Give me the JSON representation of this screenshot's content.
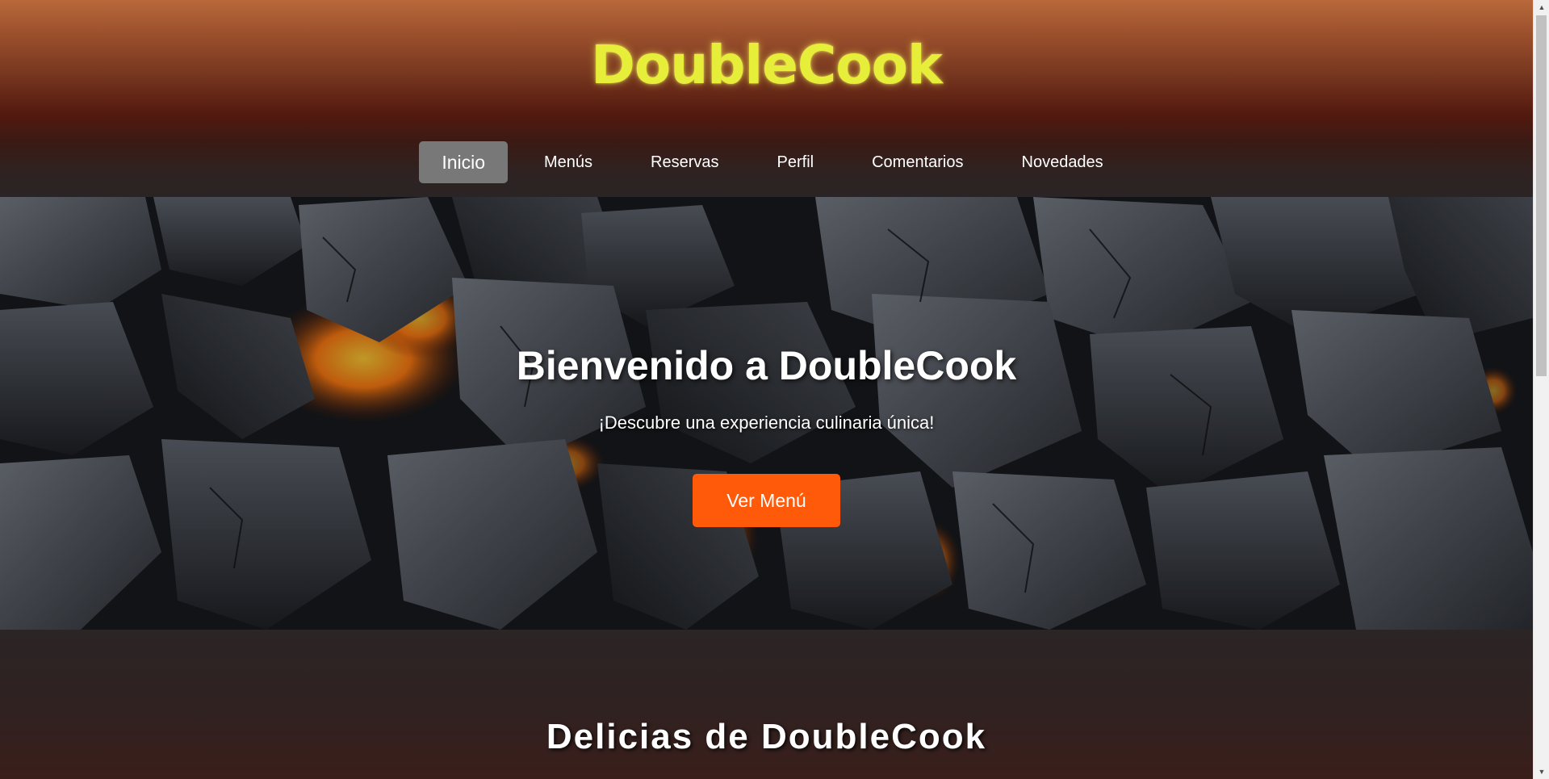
{
  "header": {
    "logo": "DoubleCook",
    "nav": [
      {
        "label": "Inicio",
        "active": true
      },
      {
        "label": "Menús",
        "active": false
      },
      {
        "label": "Reservas",
        "active": false
      },
      {
        "label": "Perfil",
        "active": false
      },
      {
        "label": "Comentarios",
        "active": false
      },
      {
        "label": "Novedades",
        "active": false
      }
    ]
  },
  "hero": {
    "title": "Bienvenido a DoubleCook",
    "subtitle": "¡Descubre una experiencia culinaria única!",
    "button_label": "Ver Menú"
  },
  "section": {
    "title": "Delicias de DoubleCook"
  },
  "scrollbar": {
    "up_icon": "triangle-up-icon",
    "down_icon": "triangle-down-icon"
  },
  "colors": {
    "logo": "#e7ee3a",
    "nav_active_bg": "#787878",
    "button_bg": "#ff5a0a"
  }
}
